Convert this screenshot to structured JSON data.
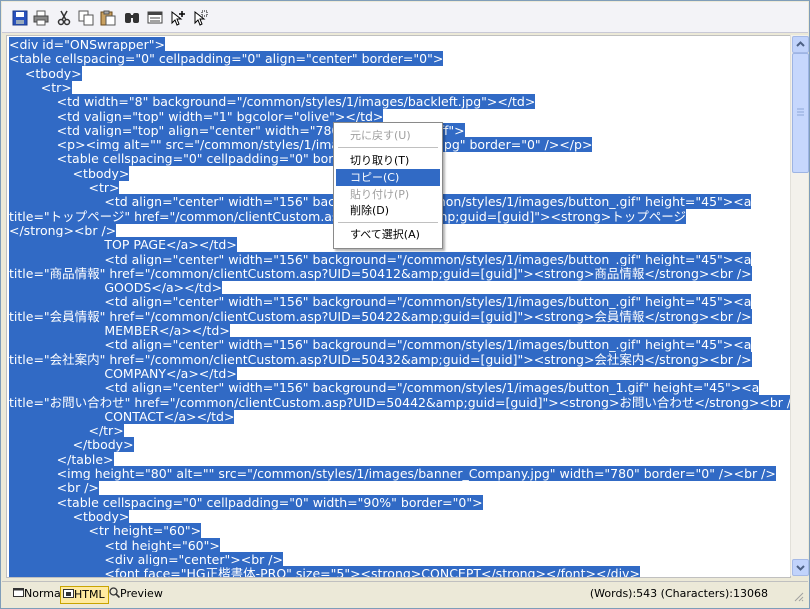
{
  "toolbar": {
    "icons": [
      "save-icon",
      "print-icon",
      "cut-icon",
      "copy-icon",
      "paste-icon",
      "find-icon",
      "preview-icon",
      "insert-icon",
      "select-icon"
    ]
  },
  "code_lines": [
    "<div id=\"ONSwrapper\">",
    "<table cellspacing=\"0\" cellpadding=\"0\" align=\"center\" border=\"0\">",
    "    <tbody>",
    "        <tr>",
    "            <td width=\"8\" background=\"/common/styles/1/images/backleft.jpg\"></td>",
    "            <td valign=\"top\" width=\"1\" bgcolor=\"olive\"></td>",
    "            <td valign=\"top\" align=\"center\" width=\"780\" bgcolor=\"#ffffff\">",
    "            <p><img alt=\"\" src=\"/common/styles/1/images/banner_top.jpg\" border=\"0\" /></p>",
    "            <table cellspacing=\"0\" cellpadding=\"0\" border=\"0\">",
    "                <tbody>",
    "                    <tr>",
    "                        <td align=\"center\" width=\"156\" background=\"/common/styles/1/images/button_.gif\" height=\"45\"><a",
    "title=\"トップページ\" href=\"/common/clientCustom.asp?UID=1000&amp;guid=[guid]\"><strong>トップページ",
    "</strong><br />",
    "                        TOP PAGE</a></td>",
    "                        <td align=\"center\" width=\"156\" background=\"/common/styles/1/images/button_.gif\" height=\"45\"><a",
    "title=\"商品情報\" href=\"/common/clientCustom.asp?UID=50412&amp;guid=[guid]\"><strong>商品情報</strong><br />",
    "                        GOODS</a></td>",
    "                        <td align=\"center\" width=\"156\" background=\"/common/styles/1/images/button_.gif\" height=\"45\"><a",
    "title=\"会員情報\" href=\"/common/clientCustom.asp?UID=50422&amp;guid=[guid]\"><strong>会員情報</strong><br />",
    "                        MEMBER</a></td>",
    "                        <td align=\"center\" width=\"156\" background=\"/common/styles/1/images/button_.gif\" height=\"45\"><a",
    "title=\"会社案内\" href=\"/common/clientCustom.asp?UID=50432&amp;guid=[guid]\"><strong>会社案内</strong><br />",
    "                        COMPANY</a></td>",
    "                        <td align=\"center\" width=\"156\" background=\"/common/styles/1/images/button_1.gif\" height=\"45\"><a",
    "title=\"お問い合わせ\" href=\"/common/clientCustom.asp?UID=50442&amp;guid=[guid]\"><strong>お問い合わせ</strong><br />",
    "                        CONTACT</a></td>",
    "                    </tr>",
    "                </tbody>",
    "            </table>",
    "            <img height=\"80\" alt=\"\" src=\"/common/styles/1/images/banner_Company.jpg\" width=\"780\" border=\"0\" /><br />",
    "            <br />",
    "            <table cellspacing=\"0\" cellpadding=\"0\" width=\"90%\" border=\"0\">",
    "                <tbody>",
    "                    <tr height=\"60\">",
    "                        <td height=\"60\">",
    "                        <div align=\"center\"><br />",
    "                        <font face=\"HG正楷書体-PRO\" size=\"5\"><strong>CONCEPT</strong></font></div>",
    "                        </td>"
  ],
  "context_menu": {
    "items": [
      {
        "label": "元に戻す(U)",
        "state": "disabled"
      },
      {
        "label": "切り取り(T)",
        "state": "enabled"
      },
      {
        "label": "コピー(C)",
        "state": "highlighted"
      },
      {
        "label": "貼り付け(P)",
        "state": "disabled"
      },
      {
        "label": "削除(D)",
        "state": "enabled"
      },
      {
        "label": "すべて選択(A)",
        "state": "enabled"
      }
    ]
  },
  "modes": [
    {
      "label": "Normal",
      "icon": "normal-icon",
      "active": false
    },
    {
      "label": "HTML",
      "icon": "html-icon",
      "active": true
    },
    {
      "label": "Preview",
      "icon": "magnifier-icon",
      "active": false
    }
  ],
  "status": {
    "word_count": "(Words):543 (Characters):13068"
  },
  "colors": {
    "selection": "#316ac5",
    "accent_active": "#ffeaa0"
  }
}
